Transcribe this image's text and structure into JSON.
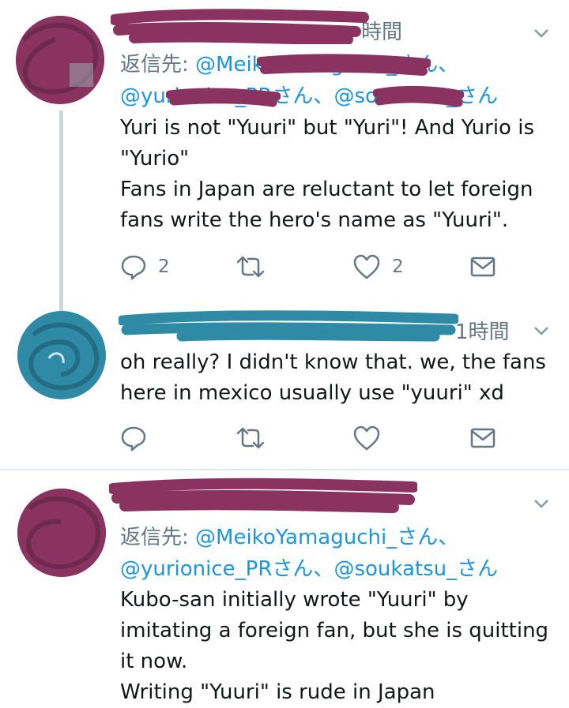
{
  "colors": {
    "text": "#14171a",
    "secondary": "#657786",
    "link": "#1b95e0",
    "scribble_maroon": "#8a3360",
    "scribble_teal": "#2f8aa6",
    "divider": "#e1e8ed",
    "thread_line": "#ccd6dd"
  },
  "tweets": [
    {
      "time": "時間",
      "reply_prefix": "返信先: ",
      "reply_line1": [
        "@MeikoYamaguchi_さん、"
      ],
      "reply_line2": [
        "@yurionice_PRさん、",
        "@soukatsu_さん"
      ],
      "body": [
        "Yuri is not \"Yuuri\" but \"Yuri\"! And Yurio is \"Yurio\"",
        "Fans in Japan are reluctant to let foreign fans write the hero's name as \"Yuuri\"."
      ],
      "reply_count": "2",
      "like_count": "2",
      "icons": [
        "reply-icon",
        "retweet-icon",
        "like-icon",
        "dm-icon",
        "chevron-down-icon"
      ]
    },
    {
      "time": "1時間",
      "ellipsis": "...",
      "body": [
        "oh really? I didn't know that. we, the fans here in mexico usually use \"yuuri\" xd"
      ],
      "icons": [
        "reply-icon",
        "retweet-icon",
        "like-icon",
        "dm-icon",
        "chevron-down-icon"
      ]
    },
    {
      "reply_prefix": "返信先: ",
      "reply_line1": [
        "@MeikoYamaguchi_さん、"
      ],
      "reply_line2": [
        "@yurionice_PRさん、",
        "@soukatsu_さん"
      ],
      "body": [
        "Kubo-san initially wrote \"Yuuri\" by imitating a foreign fan, but she is quitting it now.",
        "Writing \"Yuuri\" is rude in Japan"
      ],
      "icons": [
        "chevron-down-icon"
      ]
    }
  ]
}
